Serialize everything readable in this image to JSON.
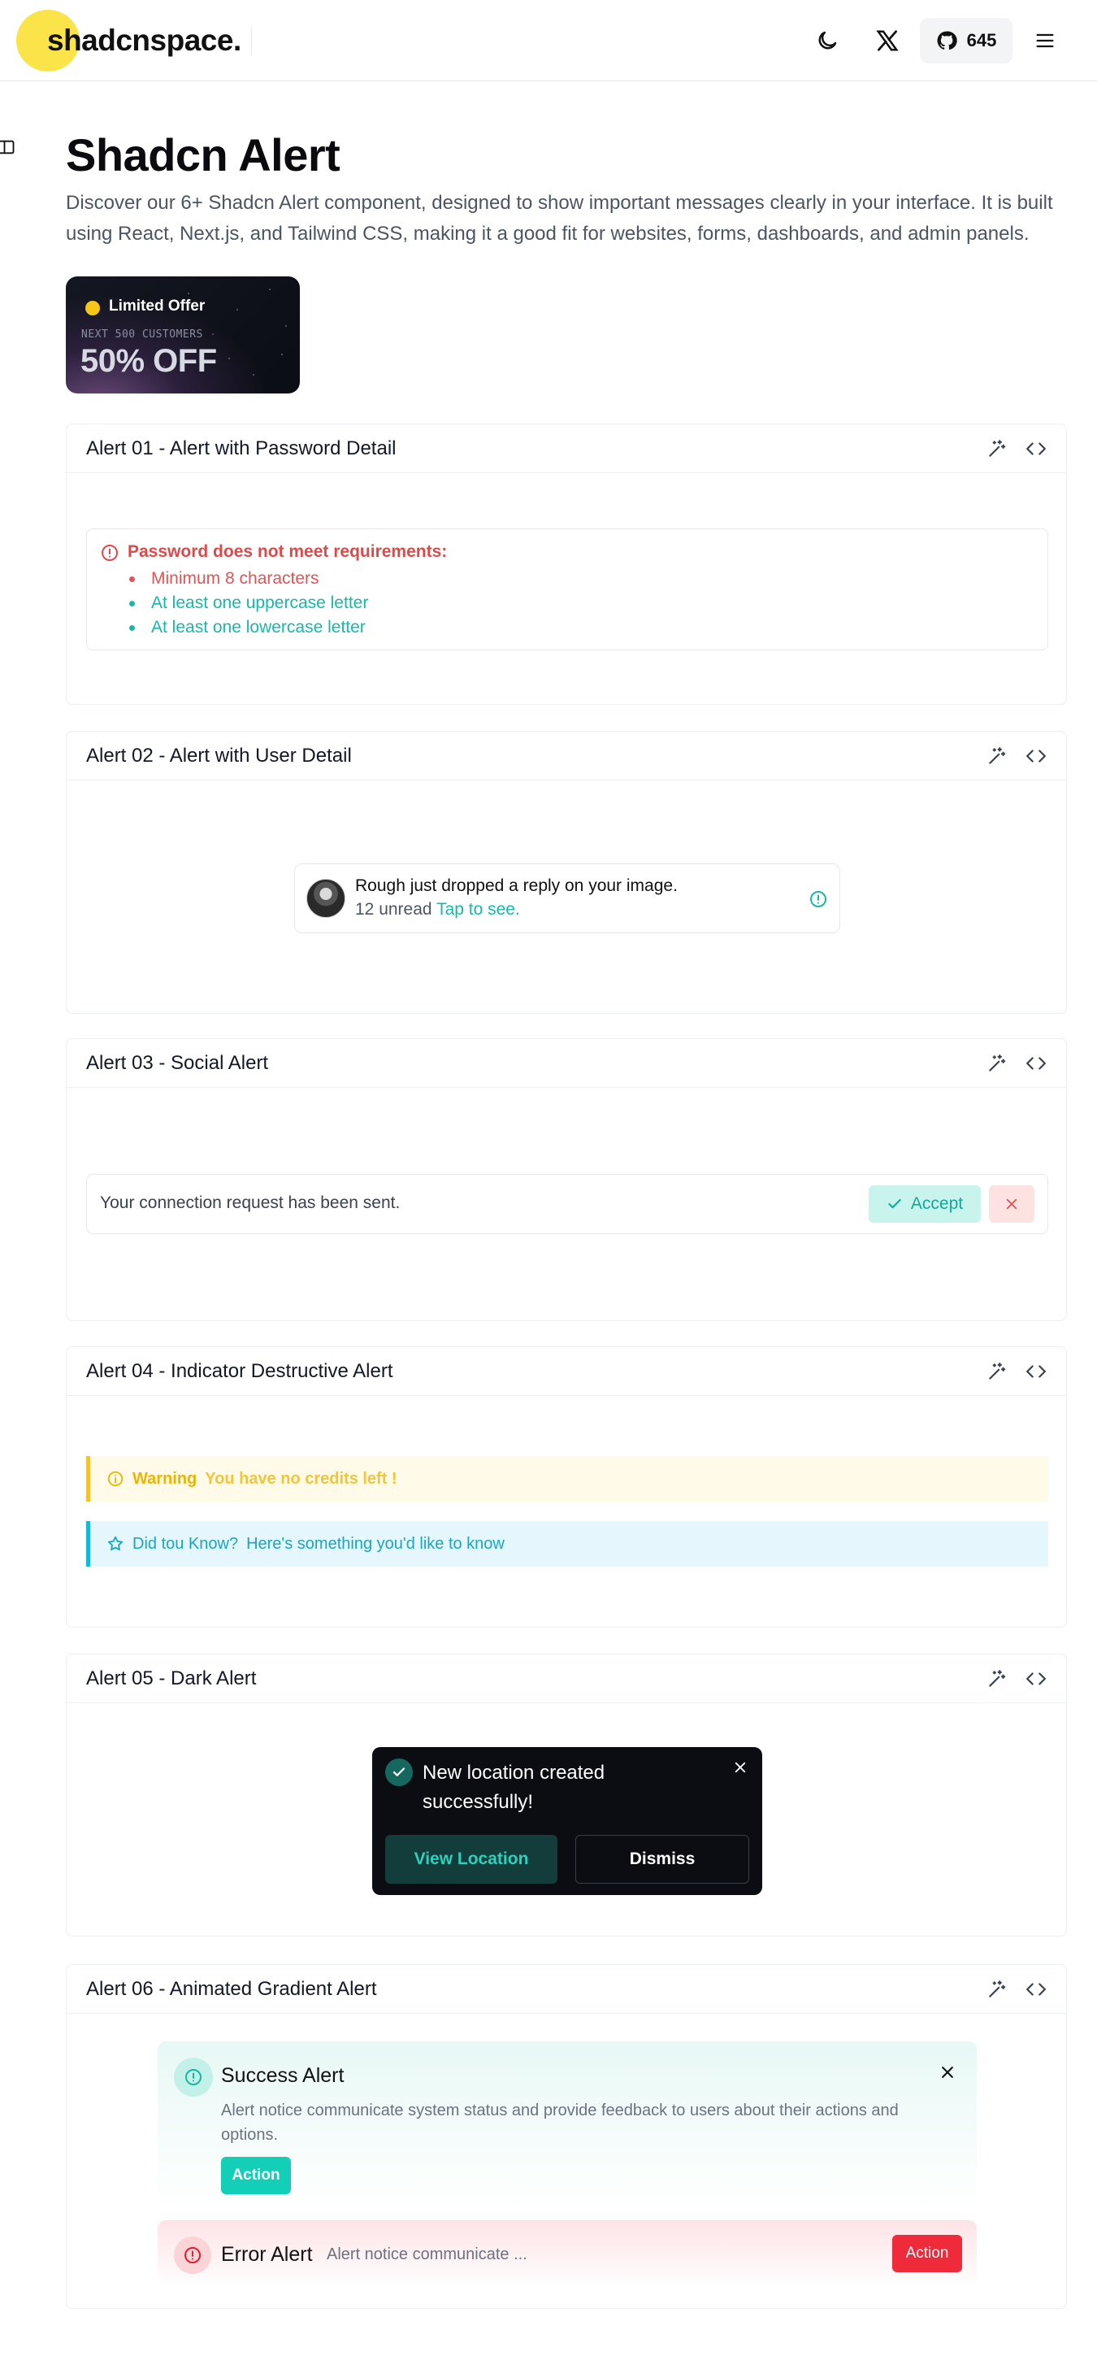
{
  "header": {
    "logo": "shadcnspace.",
    "github_stars": "645"
  },
  "page": {
    "title": "Shadcn Alert",
    "description": "Discover our 6+ Shadcn Alert component, designed to show important messages clearly in your interface. It is built using React, Next.js, and Tailwind CSS, making it a good fit for websites, forms, dashboards, and admin panels."
  },
  "promo": {
    "label": "Limited Offer",
    "sub": "NEXT 500 CUSTOMERS",
    "big": "50% OFF"
  },
  "sections": [
    {
      "title": "Alert 01 - Alert with Password Detail"
    },
    {
      "title": "Alert 02 - Alert with User Detail"
    },
    {
      "title": "Alert 03 - Social Alert"
    },
    {
      "title": "Alert 04 - Indicator Destructive Alert"
    },
    {
      "title": "Alert 05 - Dark Alert"
    },
    {
      "title": "Alert 06 - Animated Gradient Alert"
    }
  ],
  "alert01": {
    "title": "Password does not meet requirements:",
    "requirements": [
      {
        "text": "Minimum 8 characters",
        "met": false
      },
      {
        "text": "At least one uppercase letter",
        "met": true
      },
      {
        "text": "At least one lowercase letter",
        "met": true
      }
    ]
  },
  "alert02": {
    "message": "Rough just dropped a reply on your image.",
    "unread": "12 unread",
    "tap": "Tap to see."
  },
  "alert03": {
    "message": "Your connection request has been sent.",
    "accept": "Accept"
  },
  "alert04": {
    "warning_label": "Warning",
    "warning_msg": "You have no credits left !",
    "info_label": "Did tou Know?",
    "info_msg": "Here's something you'd like to know"
  },
  "alert05": {
    "title": "New location created successfully!",
    "view": "View Location",
    "dismiss": "Dismiss"
  },
  "alert06": {
    "success_title": "Success Alert",
    "success_desc": "Alert notice communicate system status and provide feedback to users about their actions and options.",
    "success_action": "Action",
    "error_title": "Error Alert",
    "error_desc": "Alert notice communicate ...",
    "error_action": "Action"
  },
  "colors": {
    "teal": "#17b8aa",
    "danger": "#dc4a4a",
    "warning": "#f4c430",
    "info": "#17b8d6",
    "logo_yellow": "#fbe34a"
  }
}
